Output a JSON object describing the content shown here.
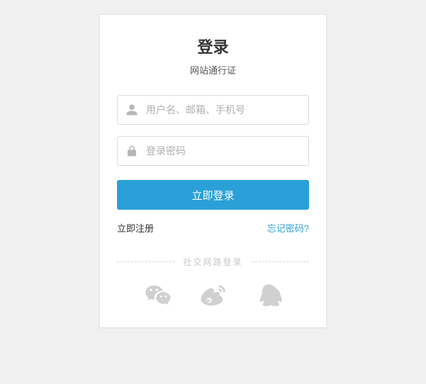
{
  "header": {
    "title": "登录",
    "subtitle": "网站通行证"
  },
  "form": {
    "username_placeholder": "用户名、邮箱、手机号",
    "username_value": "",
    "password_placeholder": "登录密码",
    "password_value": "",
    "submit_label": "立即登录"
  },
  "links": {
    "register": "立即注册",
    "forgot": "忘记密码?"
  },
  "social": {
    "label": "社交网路登录",
    "providers": [
      "wechat",
      "weibo",
      "qq"
    ]
  },
  "colors": {
    "accent": "#2aa0d8",
    "background": "#f0f0f0",
    "icon_muted": "#d0d0d0"
  }
}
